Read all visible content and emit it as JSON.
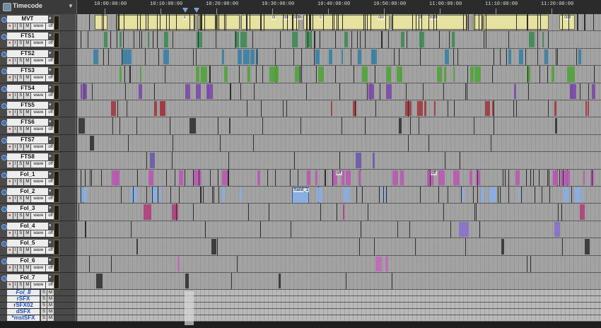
{
  "ruler": {
    "label": "Timecode",
    "ticks": [
      "10:00:00:00",
      "10:10:00:00",
      "10:20:00:00",
      "10:30:00:00",
      "10:40:00:00",
      "10:50:00:00",
      "11:00:00:00",
      "11:10:00:00",
      "11:20:00:00"
    ]
  },
  "buttons": {
    "rec": "●",
    "input": "I",
    "solo": "S",
    "mute": "M",
    "view": "wave",
    "auto": "off"
  },
  "tracks": [
    {
      "name": "MVT",
      "kind": "audio",
      "color": "#e6e2a2",
      "clip_labels": [
        "c",
        "cl",
        "clo",
        "cloth",
        "c",
        "clo",
        "cl",
        "cloth",
        "clot"
      ]
    },
    {
      "name": "FTS1",
      "kind": "audio",
      "color": "#3f8a56",
      "clip_labels": []
    },
    {
      "name": "FTS2",
      "kind": "audio",
      "color": "#3a7fa4",
      "clip_labels": []
    },
    {
      "name": "FTS3",
      "kind": "audio",
      "color": "#52a23c",
      "clip_labels": []
    },
    {
      "name": "FTS4",
      "kind": "audio",
      "color": "#7a4aa8",
      "clip_labels": []
    },
    {
      "name": "FTS5",
      "kind": "audio",
      "color": "#a03a42",
      "clip_labels": []
    },
    {
      "name": "FTS6",
      "kind": "audio",
      "color": "#333333",
      "clip_labels": []
    },
    {
      "name": "FTS7",
      "kind": "audio",
      "color": "#333333",
      "clip_labels": []
    },
    {
      "name": "FTS8",
      "kind": "audio",
      "color": "#6a5aa8",
      "clip_labels": []
    },
    {
      "name": "Fol_1",
      "kind": "audio",
      "color": "#b85ab0",
      "clip_labels": [
        "off",
        "off"
      ]
    },
    {
      "name": "Fol_2",
      "kind": "audio",
      "color": "#8aaee0",
      "clip_labels": [
        "hand_1"
      ]
    },
    {
      "name": "Fol_3",
      "kind": "audio",
      "color": "#b0407a",
      "clip_labels": []
    },
    {
      "name": "Fol_4",
      "kind": "audio",
      "color": "#8a70c8",
      "clip_labels": []
    },
    {
      "name": "Fol_5",
      "kind": "audio",
      "color": "#333333",
      "clip_labels": []
    },
    {
      "name": "Fol_6",
      "kind": "audio",
      "color": "#c06ab8",
      "clip_labels": []
    },
    {
      "name": "Fol_7",
      "kind": "audio",
      "color": "#333333",
      "clip_labels": []
    },
    {
      "name": "Fol_8",
      "kind": "aux",
      "color": "#333333",
      "clip_labels": []
    },
    {
      "name": "rSFX",
      "kind": "aux",
      "color": "#333333",
      "clip_labels": []
    },
    {
      "name": "rSFX02",
      "kind": "aux",
      "color": "#333333",
      "clip_labels": []
    },
    {
      "name": "dSFX",
      "kind": "aux",
      "color": "#333333",
      "clip_labels": []
    },
    {
      "name": "*mstSFX",
      "kind": "aux",
      "color": "#333333",
      "clip_labels": []
    }
  ]
}
